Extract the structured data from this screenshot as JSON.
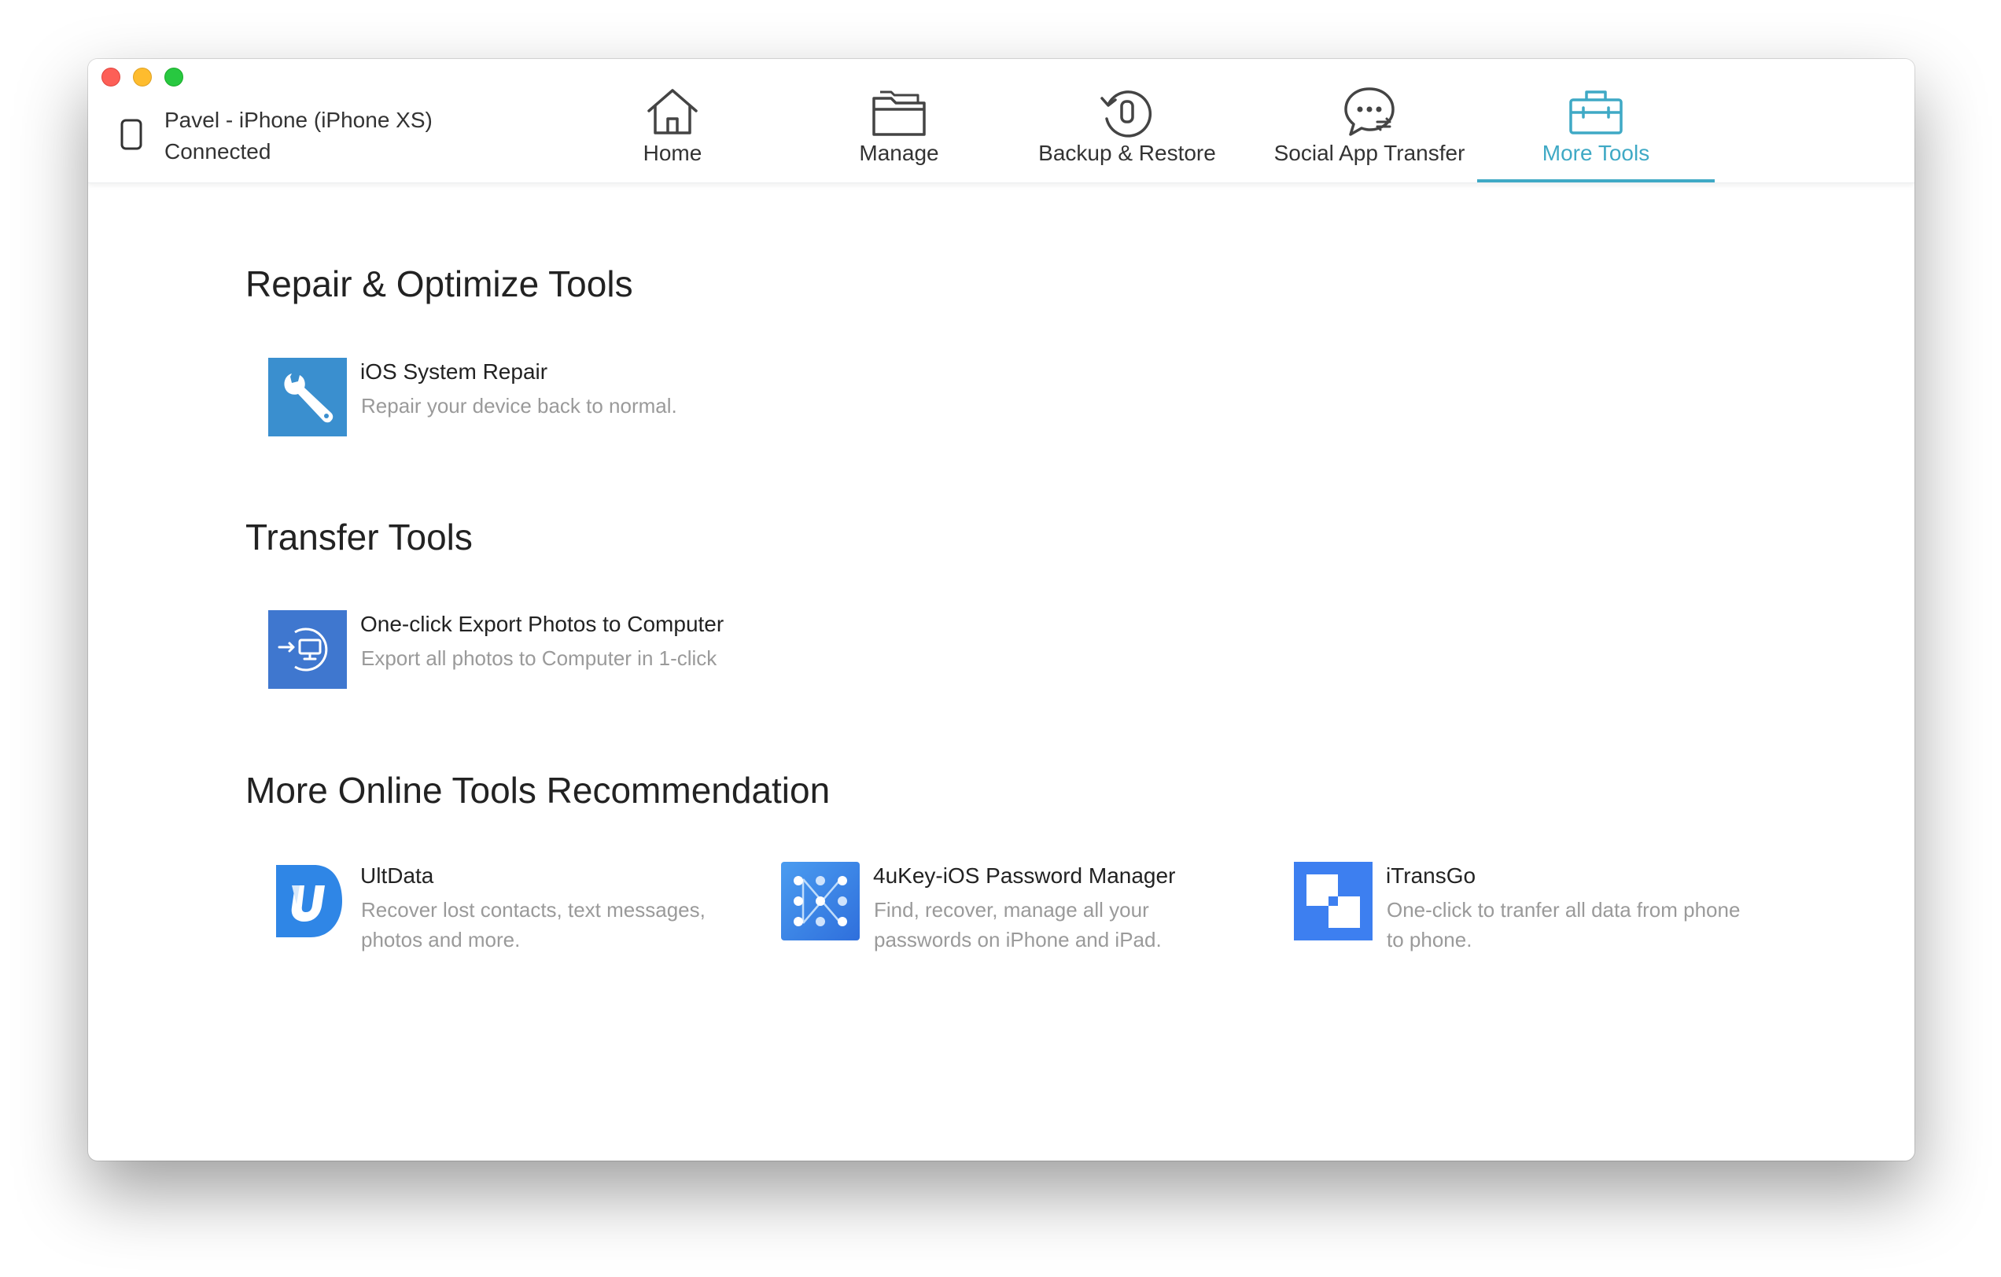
{
  "device": {
    "name": "Pavel - iPhone (iPhone XS)",
    "status": "Connected",
    "icon": "phone-icon"
  },
  "tabs": [
    {
      "label": "Home",
      "icon": "home-icon",
      "active": false
    },
    {
      "label": "Manage",
      "icon": "folder-icon",
      "active": false
    },
    {
      "label": "Backup & Restore",
      "icon": "backup-restore-icon",
      "active": false
    },
    {
      "label": "Social App Transfer",
      "icon": "chat-transfer-icon",
      "active": false
    },
    {
      "label": "More Tools",
      "icon": "toolbox-icon",
      "active": true
    }
  ],
  "sections": {
    "repair": {
      "title": "Repair & Optimize Tools",
      "tools": [
        {
          "name": "iOS System Repair",
          "desc": "Repair your device back to normal.",
          "icon": "wrench-icon"
        }
      ]
    },
    "transfer": {
      "title": "Transfer Tools",
      "tools": [
        {
          "name": "One-click Export Photos to Computer",
          "desc": "Export all photos to Computer in 1-click",
          "icon": "export-computer-icon"
        }
      ]
    },
    "online": {
      "title": "More Online Tools Recommendation",
      "tools": [
        {
          "name": "UltData",
          "desc": "Recover lost contacts, text messages, photos and more.",
          "icon": "ultdata-icon"
        },
        {
          "name": "4uKey-iOS Password Manager",
          "desc": "Find, recover, manage all your passwords on iPhone and iPad.",
          "icon": "4ukey-icon"
        },
        {
          "name": "iTransGo",
          "desc": "One-click to tranfer all data from phone to phone.",
          "icon": "itransgo-icon"
        }
      ]
    }
  },
  "colors": {
    "accent": "#3fa9c5",
    "repair_icon_bg": "#3a8fcf",
    "transfer_icon_bg": "#3f77cf",
    "ultdata_blue": "#2f86e6",
    "fourukey_blue": "#3a86ea",
    "itransgo_blue": "#3d7ff0"
  }
}
